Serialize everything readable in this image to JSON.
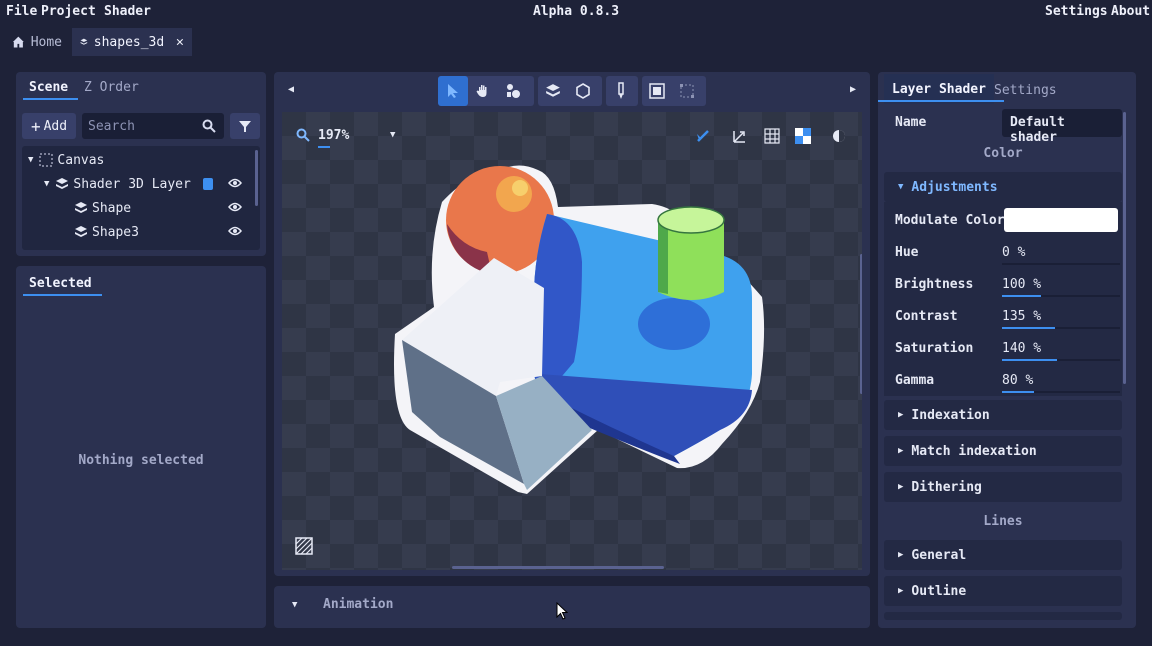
{
  "menubar": {
    "file": "File",
    "project": "Project",
    "shader": "Shader",
    "title": "Alpha 0.8.3",
    "settings": "Settings",
    "about": "About"
  },
  "tabs": [
    {
      "label": "Home"
    },
    {
      "label": "shapes_3d"
    }
  ],
  "scene_panel": {
    "tabs": [
      "Scene",
      "Z Order"
    ],
    "add_label": "Add",
    "search_placeholder": "Search",
    "tree": [
      {
        "label": "Canvas",
        "depth": 0
      },
      {
        "label": "Shader 3D Layer",
        "depth": 1
      },
      {
        "label": "Shape",
        "depth": 2
      },
      {
        "label": "Shape3",
        "depth": 2
      }
    ]
  },
  "selected_panel": {
    "tab": "Selected",
    "empty_text": "Nothing selected"
  },
  "viewport": {
    "zoom": "197%"
  },
  "animation": {
    "label": "Animation"
  },
  "right_panel": {
    "tabs": [
      "Layer Shader",
      "Settings"
    ],
    "name_label": "Name",
    "name_value": "Default shader",
    "color_section": "Color",
    "adjustments_label": "Adjustments",
    "modulate_label": "Modulate Color",
    "modulate_color": "#ffffff",
    "adjustments": [
      {
        "label": "Hue",
        "value": "0 %",
        "fill": 0.0
      },
      {
        "label": "Brightness",
        "value": "100 %",
        "fill": 0.33
      },
      {
        "label": "Contrast",
        "value": "135 %",
        "fill": 0.45
      },
      {
        "label": "Saturation",
        "value": "140 %",
        "fill": 0.47
      },
      {
        "label": "Gamma",
        "value": "80 %",
        "fill": 0.27
      }
    ],
    "collapsibles_color": [
      "Indexation",
      "Match indexation",
      "Dithering"
    ],
    "lines_section": "Lines",
    "collapsibles_lines": [
      "General",
      "Outline"
    ]
  },
  "colors": {
    "accent": "#3d8ff0",
    "panel": "#2b3150",
    "background": "#1e2238"
  }
}
